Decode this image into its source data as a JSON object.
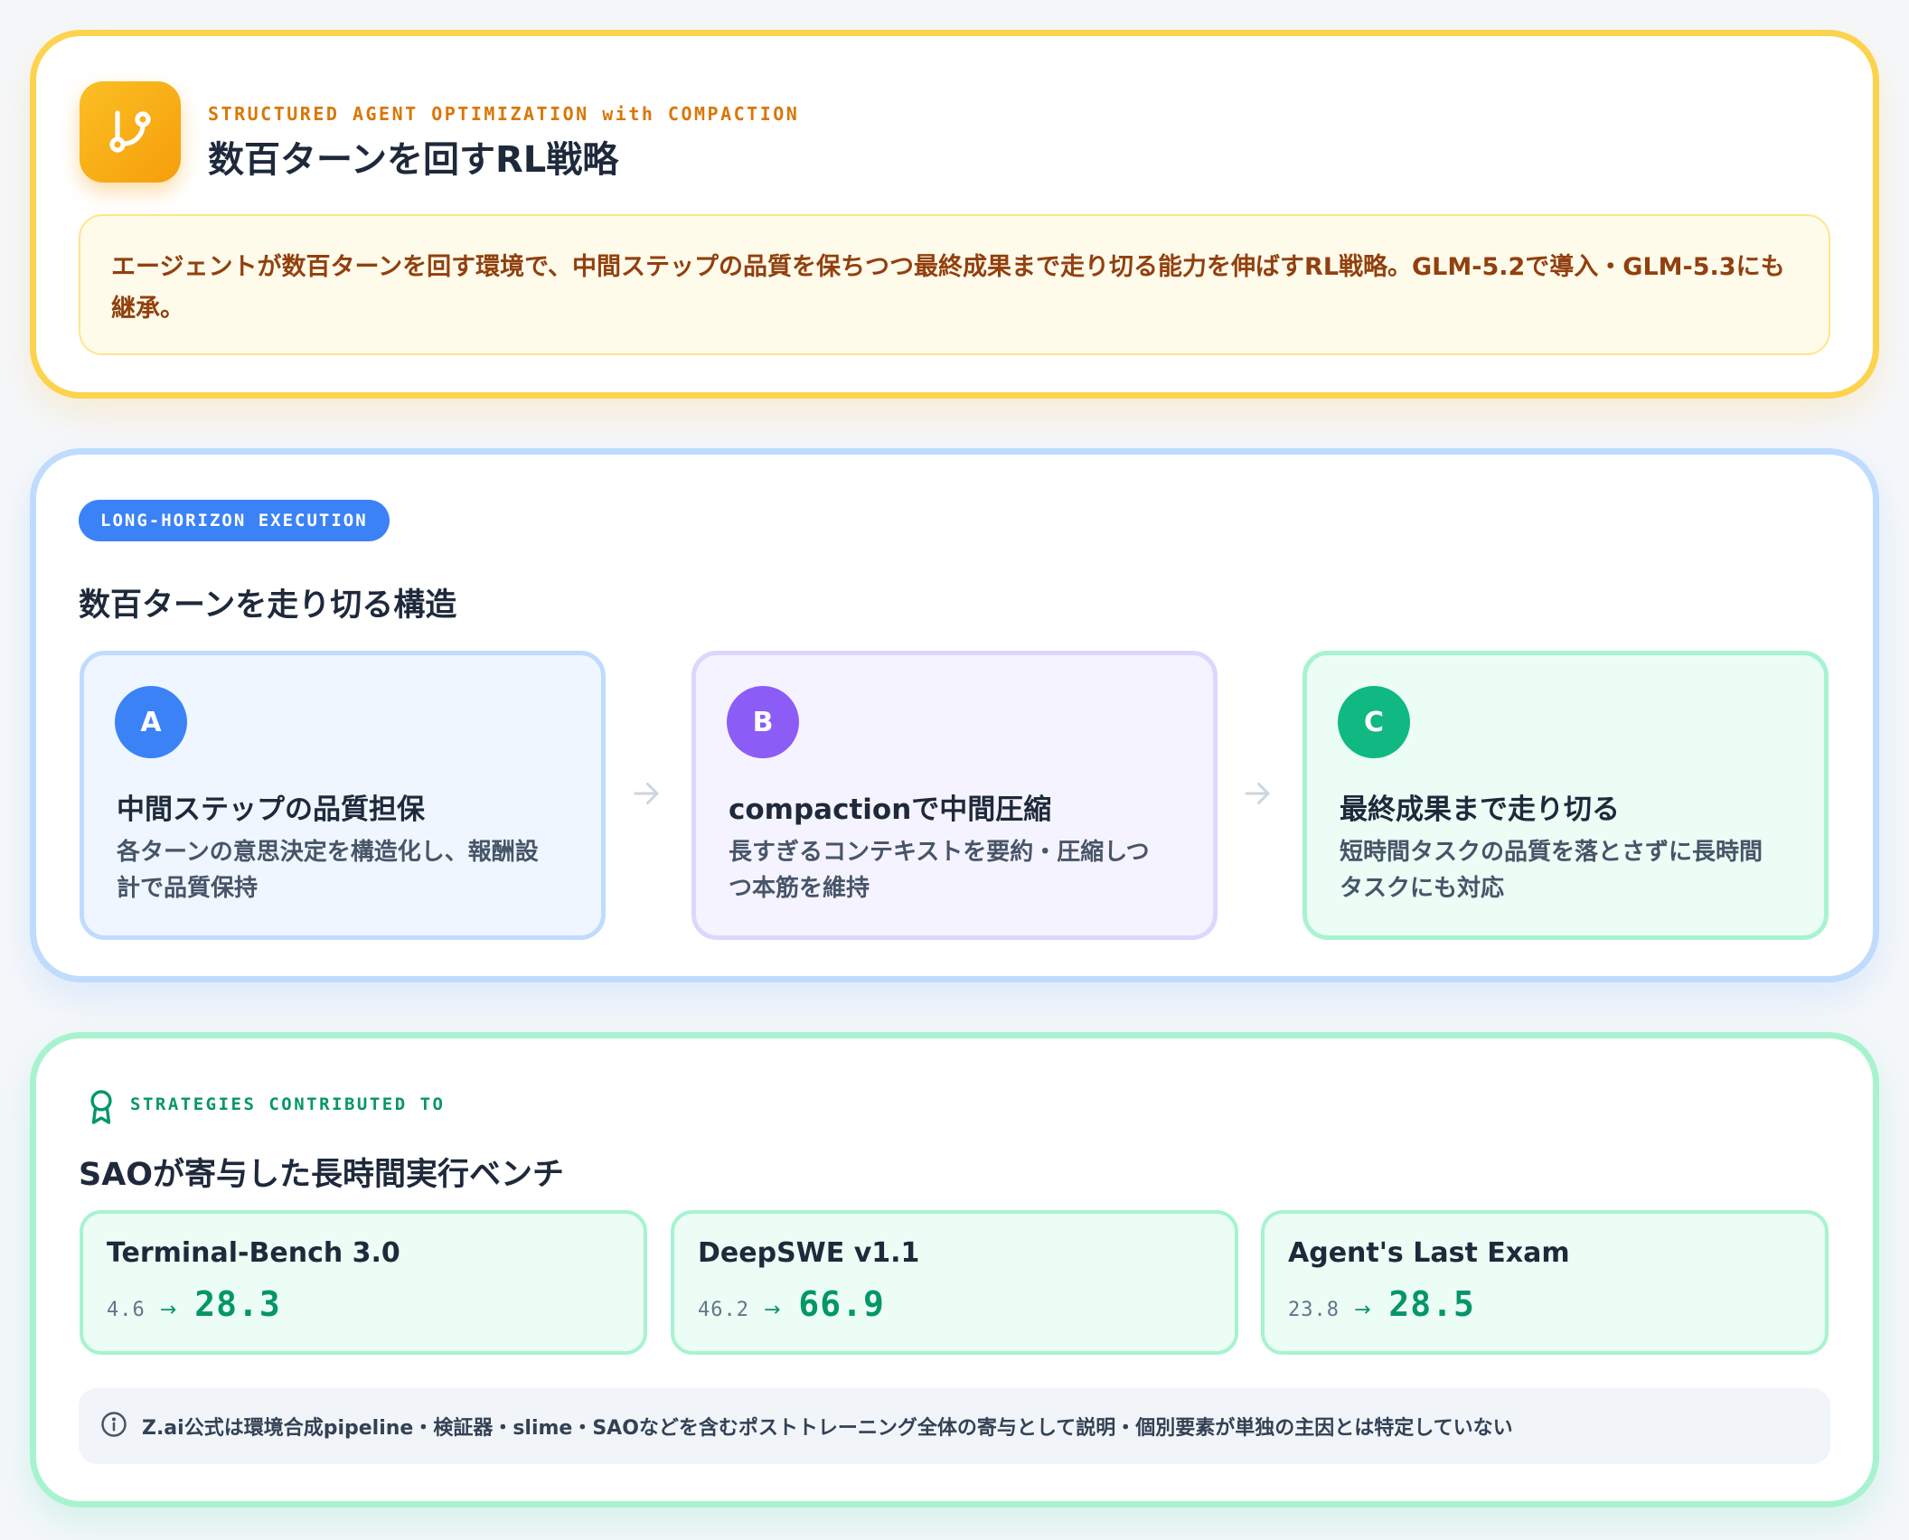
{
  "header": {
    "icon": "git-branch-icon",
    "eyebrow": "STRUCTURED AGENT OPTIMIZATION with COMPACTION",
    "title": "数百ターンを回すRL戦略",
    "summary": "エージェントが数百ターンを回す環境で、中間ステップの品質を保ちつつ最終成果まで走り切る能力を伸ばすRL戦略。GLM-5.2で導入・GLM-5.3にも継承。"
  },
  "structure": {
    "tag": "LONG-HORIZON EXECUTION",
    "title": "数百ターンを走り切る構造",
    "steps": [
      {
        "badge": "A",
        "title": "中間ステップの品質担保",
        "desc": "各ターンの意思決定を構造化し、報酬設計で品質保持",
        "color": "#3b82f6"
      },
      {
        "badge": "B",
        "title": "compactionで中間圧縮",
        "desc": "長すぎるコンテキストを要約・圧縮しつつ本筋を維持",
        "color": "#8b5cf6"
      },
      {
        "badge": "C",
        "title": "最終成果まで走り切る",
        "desc": "短時間タスクの品質を落とさずに長時間タスクにも対応",
        "color": "#10b981"
      }
    ]
  },
  "benchmarks": {
    "icon": "award-icon",
    "eyebrow": "STRATEGIES CONTRIBUTED TO",
    "title": "SAOが寄与した長時間実行ベンチ",
    "items": [
      {
        "name": "Terminal-Bench 3.0",
        "before": "4.6",
        "after": "28.3"
      },
      {
        "name": "DeepSWE v1.1",
        "before": "46.2",
        "after": "66.9"
      },
      {
        "name": "Agent's Last Exam",
        "before": "23.8",
        "after": "28.5"
      }
    ],
    "note": "Z.ai公式は環境合成pipeline・検証器・slime・SAOなどを含むポストトレーニング全体の寄与として説明・個別要素が単独の主因とは特定していない"
  },
  "colors": {
    "accent_orange": "#f59e0b",
    "accent_blue": "#3b82f6",
    "accent_green": "#059669"
  }
}
